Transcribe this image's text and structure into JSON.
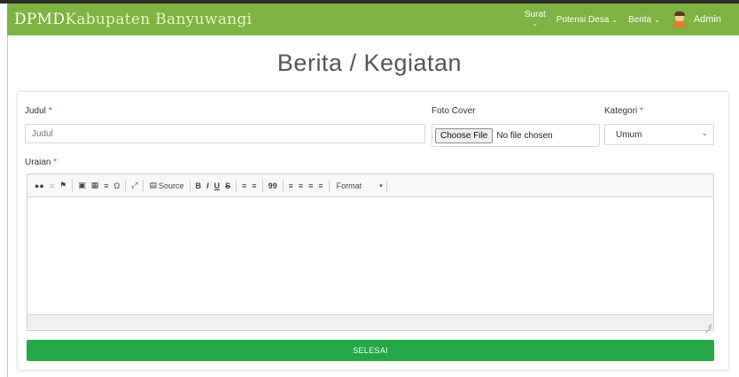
{
  "navbar": {
    "brand_primary": "DPMD",
    "brand_secondary": "Kabupaten Banyuwangi",
    "menu": [
      {
        "label": "Surat"
      },
      {
        "label": "Potensi Desa"
      },
      {
        "label": "Berita"
      }
    ],
    "user_label": "Admin",
    "color": "#7cb342"
  },
  "page": {
    "title": "Berita / Kegiatan"
  },
  "form": {
    "judul": {
      "label": "Judul",
      "required_mark": "*",
      "placeholder": "Judul",
      "value": ""
    },
    "foto_cover": {
      "label": "Foto Cover",
      "button_label": "Choose File",
      "status_text": "No file chosen"
    },
    "kategori": {
      "label": "Kategori",
      "required_mark": "*",
      "selected": "Umum"
    },
    "uraian": {
      "label": "Uraian",
      "required_mark": "*"
    },
    "toolbar": {
      "source_label": "Source",
      "bold_label": "B",
      "italic_label": "I",
      "underline_label": "U",
      "strike_label": "S",
      "format_label": "Format",
      "special_char": "Ω",
      "quote_glyph": "99"
    },
    "submit_label": "SELESAI",
    "submit_color": "#22a845"
  }
}
